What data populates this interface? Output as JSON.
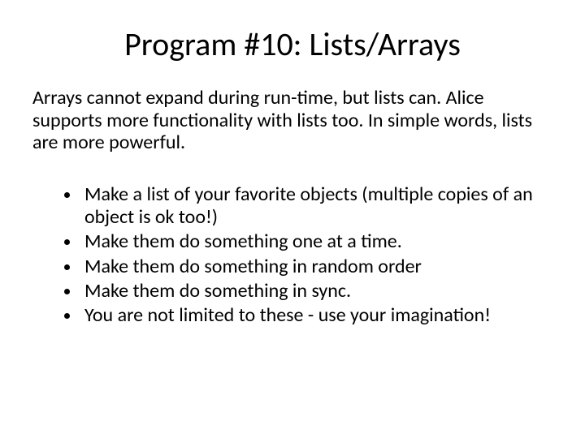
{
  "title": "Program #10: Lists/Arrays",
  "intro": "Arrays cannot expand during run-time, but lists can. Alice supports more functionality with lists too. In simple words, lists are more powerful.",
  "bullets": [
    "Make a list of your favorite objects (multiple copies of an object is ok too!)",
    "Make them do something one at a time.",
    "Make them do something in random order",
    "Make them do something in sync.",
    "You are not limited to these - use your imagination!"
  ]
}
